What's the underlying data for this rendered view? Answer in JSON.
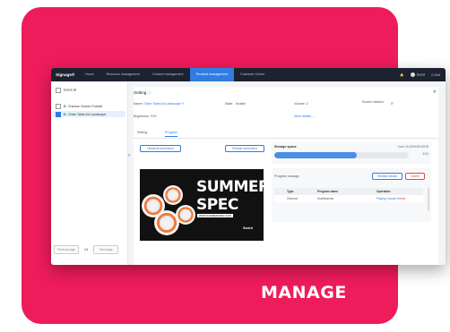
{
  "caption": "MANAGE",
  "colors": {
    "card": "#ee1c5a",
    "topbar": "#1c2230",
    "accent": "#2f7de1"
  },
  "topbar": {
    "logo": "Signage®",
    "nav": [
      "Home",
      "Resource management",
      "Content management",
      "Terminal management",
      "Customer Center"
    ],
    "active_index": 3,
    "bell": "🔔",
    "user": "Guest",
    "exit": "⏻ Exit"
  },
  "sidebar": {
    "select_all": "Select all",
    "devices": [
      "Chinese Screen Portrait",
      "Order Table Ad Landscape"
    ],
    "pager": {
      "prev": "Previous page",
      "page": "1/1",
      "next": "Next page"
    }
  },
  "panel": {
    "title": "Setting",
    "info_icon": "ⓘ",
    "close": "✕",
    "fields": {
      "name_label": "Name:",
      "name_value": "Order Table Ad Landscape ✎",
      "state_label": "State:",
      "state_value": "Enable",
      "volume_label": "Volume:",
      "volume_value": "2",
      "rotation_label": "Screen rotation:",
      "rotation_value": "0°",
      "brightness_label": "Brightness:",
      "brightness_value": "70%",
      "more_details": "More details →"
    },
    "tabs": [
      "Setting",
      "Program"
    ],
    "active_tab": 1,
    "buttons": {
      "left": "Historical screenshot",
      "right": "Remote screenshot"
    },
    "preview": {
      "line1": "SUMMER",
      "line2": "SPEC",
      "sub": "WWW.SUMMERSPEC.COM",
      "brand": "Sushi"
    },
    "storage": {
      "title": "Storage space",
      "used_text": "Used 28.45GB/58.50GB",
      "percent_text": "61%",
      "percent": 0.61
    },
    "program": {
      "title": "Program manage",
      "btn_details": "Release details",
      "btn_delete": "Delete",
      "columns": [
        "Type",
        "Program name",
        "Operation"
      ],
      "rows": [
        {
          "type": "General",
          "name": "Sushibanner",
          "ops": [
            "Playing",
            "Cancel",
            "Delete"
          ]
        }
      ]
    }
  }
}
